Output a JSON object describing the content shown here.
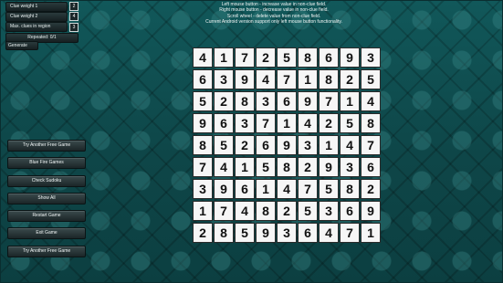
{
  "options": {
    "rows": [
      {
        "label": "Clue weight 1",
        "value": "2"
      },
      {
        "label": "Clue weight 2",
        "value": "4"
      },
      {
        "label": "Max. clues in region",
        "value": "3"
      }
    ],
    "repeated": "Repeated: 0/1",
    "generate": "Generate"
  },
  "instructions": [
    "Left mouse button - increase value in non-clue field.",
    "Right mouse button - decrease value in non-clue field.",
    "Scroll wheel - delete value from non-clue field.",
    "Current Android version support only left mouse button functionality."
  ],
  "grid": [
    [
      "4",
      "1",
      "7",
      "2",
      "5",
      "8",
      "6",
      "9",
      "3"
    ],
    [
      "6",
      "3",
      "9",
      "4",
      "7",
      "1",
      "8",
      "2",
      "5"
    ],
    [
      "5",
      "2",
      "8",
      "3",
      "6",
      "9",
      "7",
      "1",
      "4"
    ],
    [
      "9",
      "6",
      "3",
      "7",
      "1",
      "4",
      "2",
      "5",
      "8"
    ],
    [
      "8",
      "5",
      "2",
      "6",
      "9",
      "3",
      "1",
      "4",
      "7"
    ],
    [
      "7",
      "4",
      "1",
      "5",
      "8",
      "2",
      "9",
      "3",
      "6"
    ],
    [
      "3",
      "9",
      "6",
      "1",
      "4",
      "7",
      "5",
      "8",
      "2"
    ],
    [
      "1",
      "7",
      "4",
      "8",
      "2",
      "5",
      "3",
      "6",
      "9"
    ],
    [
      "2",
      "8",
      "5",
      "9",
      "3",
      "6",
      "4",
      "7",
      "1"
    ]
  ],
  "buttons": [
    "Try Another Free Game",
    "Blue Fire Games",
    "Check Sudoku",
    "Show All",
    "Restart Game",
    "Exit Game",
    "Try Another Free Game"
  ]
}
